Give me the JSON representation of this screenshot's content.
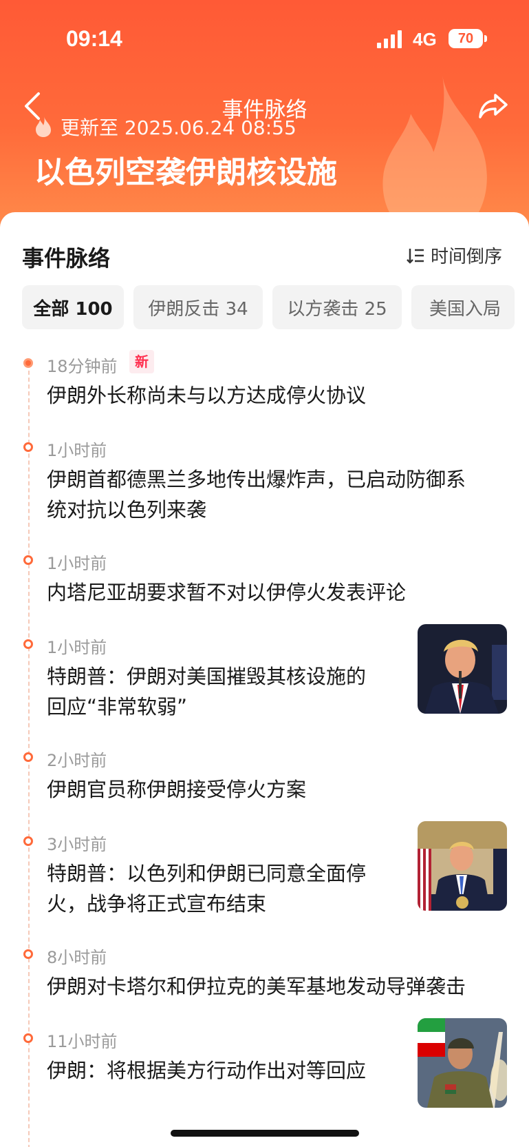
{
  "status_bar": {
    "time": "09:14",
    "network": "4G",
    "battery": "70"
  },
  "header": {
    "nav_title": "事件脉络",
    "update_text": "更新至 2025.06.24 08:55",
    "event_title": "以色列空袭伊朗核设施"
  },
  "section": {
    "title": "事件脉络",
    "sort_label": "时间倒序"
  },
  "filters": [
    {
      "label": "全部 100",
      "active": true
    },
    {
      "label": "伊朗反击 34",
      "active": false
    },
    {
      "label": "以方袭击 25",
      "active": false
    },
    {
      "label": "美国入局",
      "active": false
    }
  ],
  "timeline": [
    {
      "time": "18分钟前",
      "badge": "新",
      "lines": [
        "伊朗外长称尚未与以方达成停火协议"
      ]
    },
    {
      "time": "1小时前",
      "lines": [
        "伊朗首都德黑兰多地传出爆炸声，已启动防御系",
        "统对抗以色列来袭"
      ]
    },
    {
      "time": "1小时前",
      "lines": [
        "内塔尼亚胡要求暂不对以伊停火发表评论"
      ]
    },
    {
      "time": "1小时前",
      "lines": [
        "特朗普：伊朗对美国摧毁其核设施的",
        "回应“非常软弱”"
      ],
      "image": "trump-portrait"
    },
    {
      "time": "2小时前",
      "lines": [
        "伊朗官员称伊朗接受停火方案"
      ]
    },
    {
      "time": "3小时前",
      "lines": [
        "特朗普：以色列和伊朗已同意全面停",
        "火，战争将正式宣布结束"
      ],
      "image": "trump-podium"
    },
    {
      "time": "8小时前",
      "lines": [
        "伊朗对卡塔尔和伊拉克的美军基地发动导弹袭击"
      ]
    },
    {
      "time": "11小时前",
      "lines": [
        "伊朗：将根据美方行动作出对等回应"
      ],
      "image": "iran-general"
    }
  ],
  "colors": {
    "accent": "#ff5a36",
    "badge": "#ff2f4f"
  }
}
